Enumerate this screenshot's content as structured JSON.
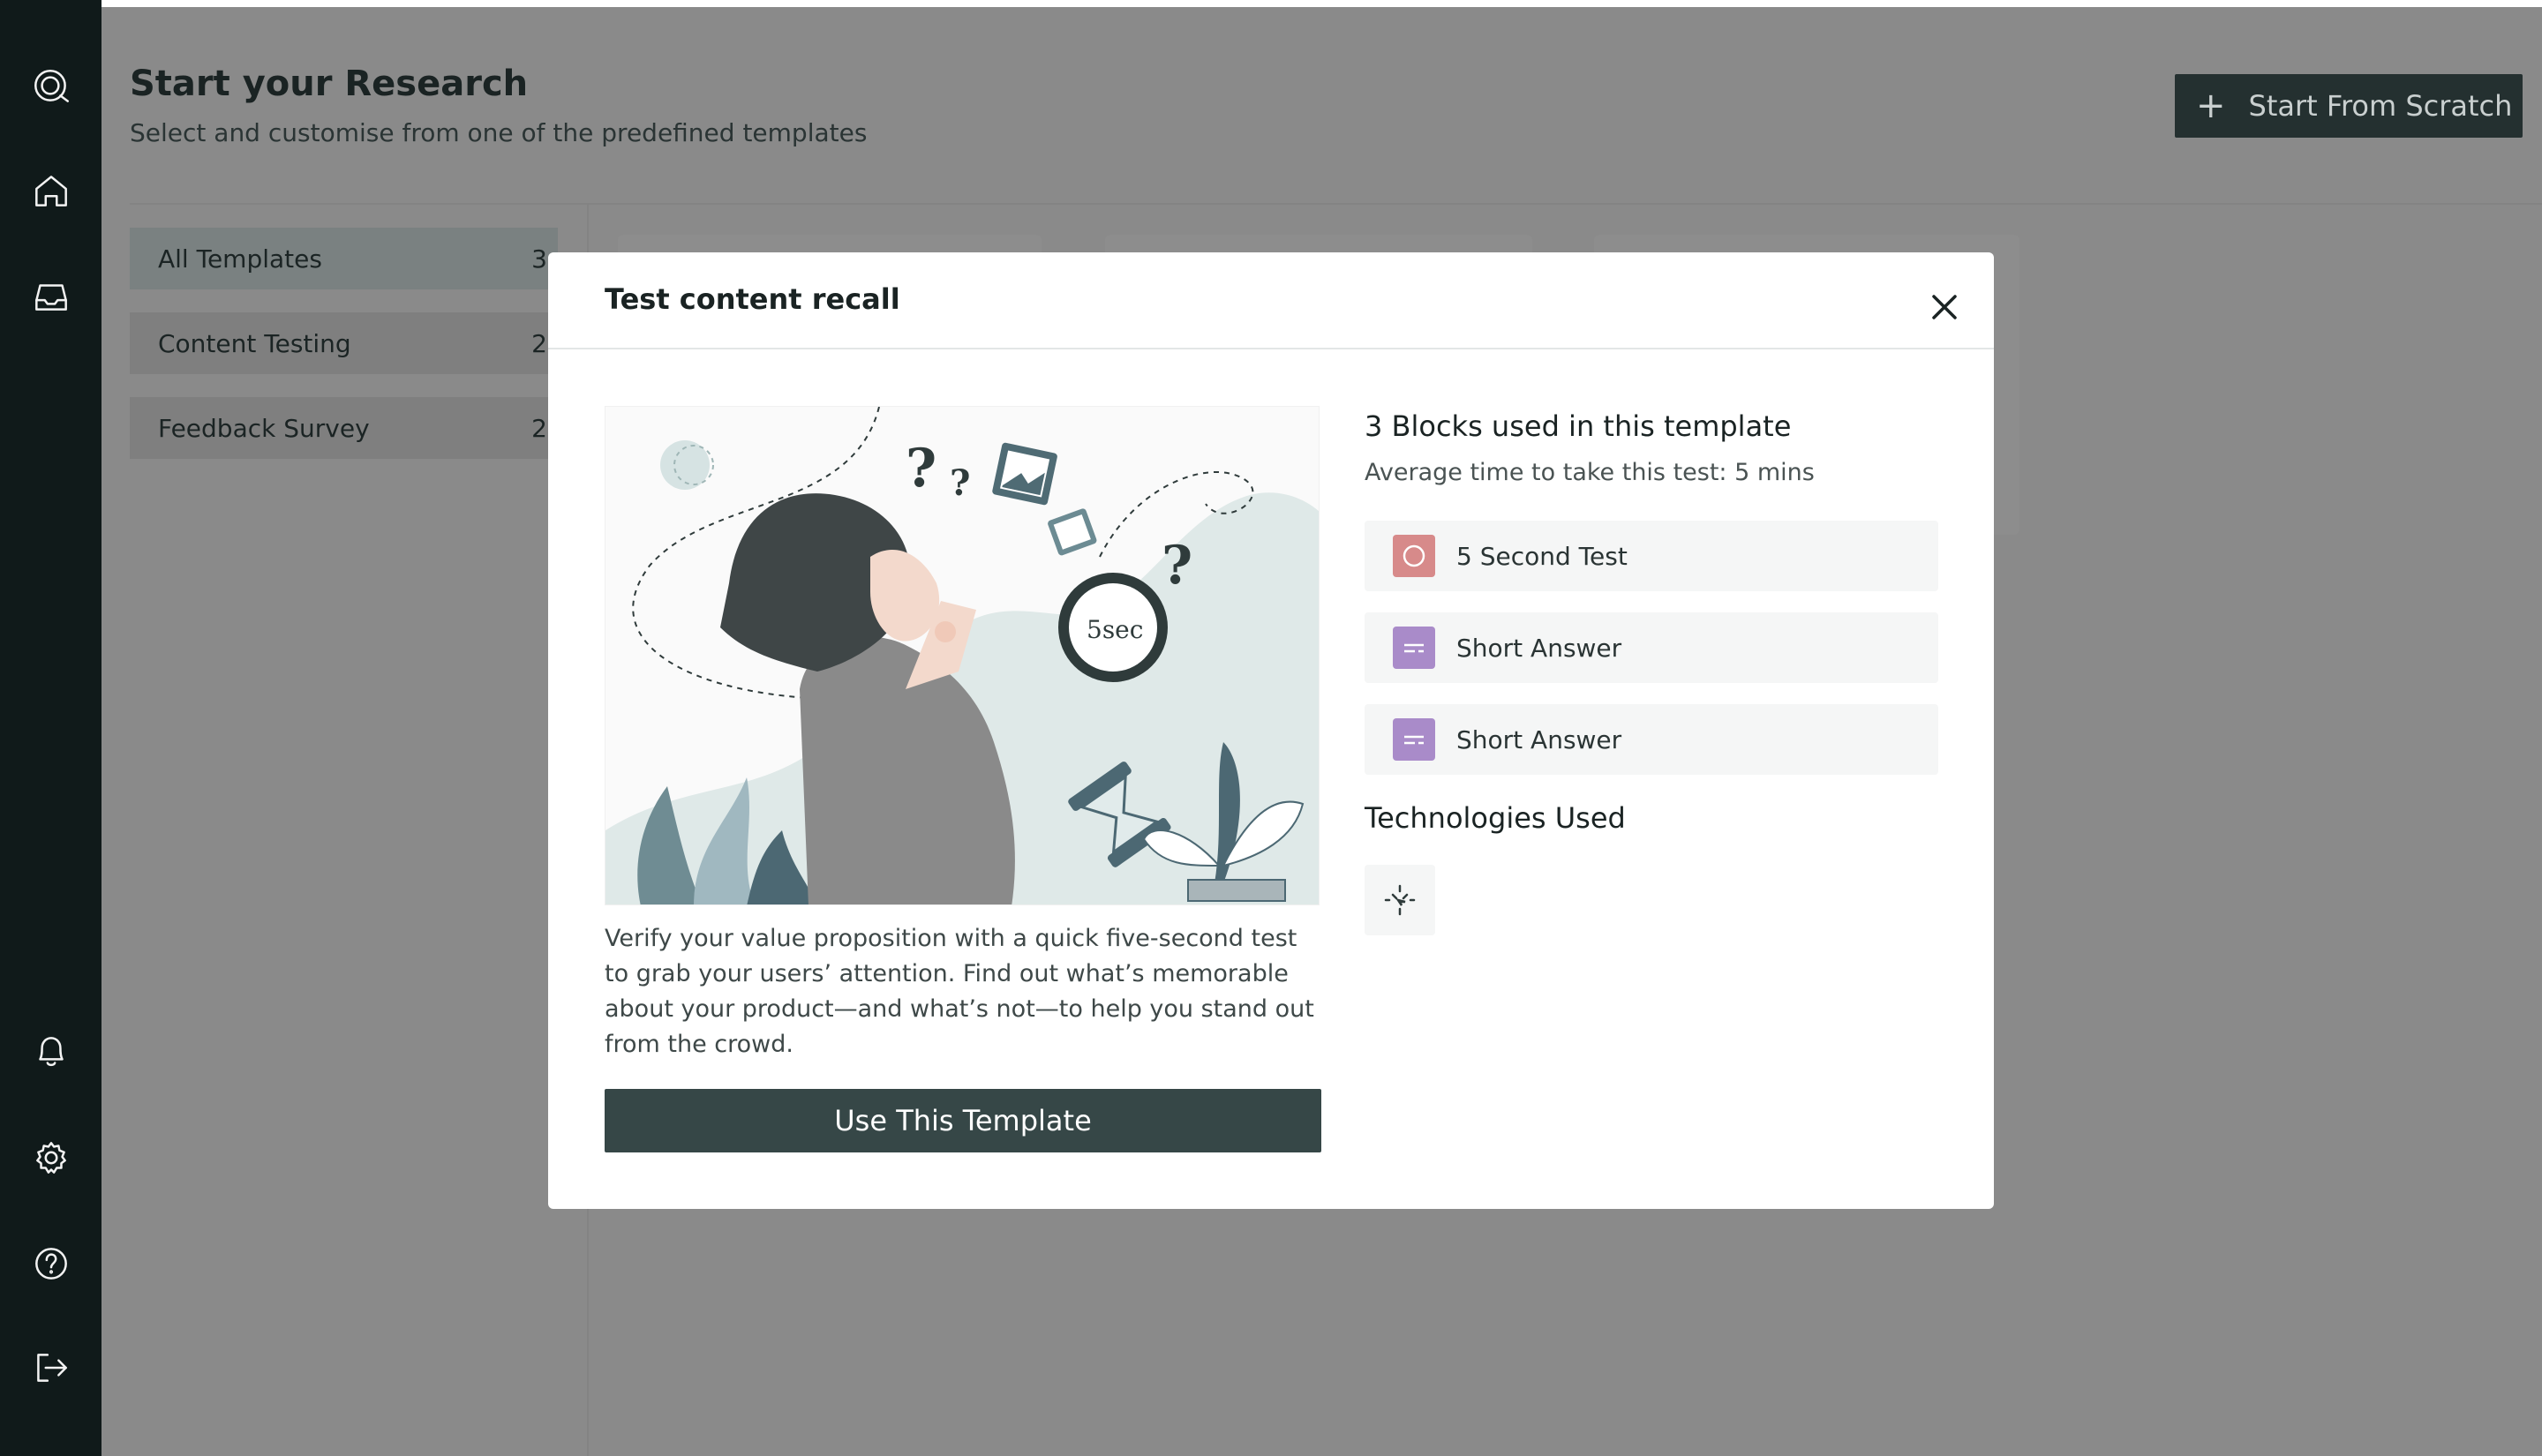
{
  "header": {
    "title": "Start your Research",
    "subtitle": "Select and customise from one of the predefined templates",
    "start_button": "Start From Scratch"
  },
  "filters": [
    {
      "label": "All Templates",
      "count": "3"
    },
    {
      "label": "Content Testing",
      "count": "2"
    },
    {
      "label": "Feedback Survey",
      "count": "2"
    }
  ],
  "modal": {
    "title": "Test content recall",
    "description": "Verify your value proposition with a quick five-second test to grab your users’ attention. Find out what’s memorable about your product—and what’s not—to help you stand out from the crowd.",
    "use_button": "Use This Template",
    "blocks_title": "3 Blocks used in this template",
    "avg_time": "Average time to take this test: 5 mins",
    "blocks": [
      {
        "label": "5 Second Test",
        "icon": "five-second-test-icon",
        "color": "#d78a8a"
      },
      {
        "label": "Short Answer",
        "icon": "short-answer-icon",
        "color": "#a98bc9"
      },
      {
        "label": "Short Answer",
        "icon": "short-answer-icon",
        "color": "#a98bc9"
      }
    ],
    "tech_title": "Technologies Used",
    "illustration_text": "5sec"
  },
  "colors": {
    "sidebar": "#101a1a",
    "primary_button": "#364747",
    "overlay": "#8a8a8a"
  }
}
